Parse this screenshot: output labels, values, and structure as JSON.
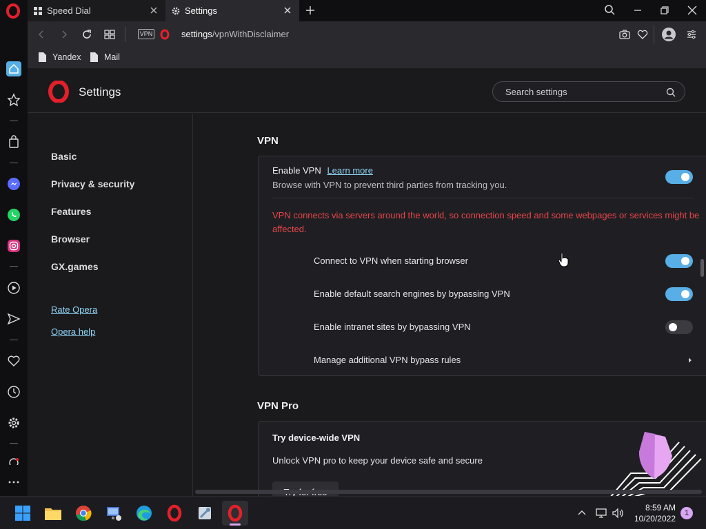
{
  "tabs": [
    {
      "label": "Speed Dial"
    },
    {
      "label": "Settings"
    }
  ],
  "address": {
    "url_host": "settings",
    "url_path": "/vpnWithDisclaimer",
    "vpn_badge": "VPN"
  },
  "bookmarks": [
    {
      "label": "Yandex"
    },
    {
      "label": "Mail"
    }
  ],
  "header": {
    "title": "Settings",
    "search_placeholder": "Search settings"
  },
  "nav": {
    "items": [
      {
        "label": "Basic"
      },
      {
        "label": "Privacy & security"
      },
      {
        "label": "Features"
      },
      {
        "label": "Browser"
      },
      {
        "label": "GX.games"
      }
    ],
    "links": [
      {
        "label": "Rate Opera"
      },
      {
        "label": "Opera help"
      }
    ]
  },
  "vpn": {
    "section_title": "VPN",
    "enable_label": "Enable VPN",
    "learn_more": "Learn more",
    "enable_desc": "Browse with VPN to prevent third parties from tracking you.",
    "enable_on": true,
    "warning": "VPN connects via servers around the world, so connection speed and some webpages or services might be affected.",
    "options": [
      {
        "label": "Connect to VPN when starting browser",
        "on": true
      },
      {
        "label": "Enable default search engines by bypassing VPN",
        "on": true
      },
      {
        "label": "Enable intranet sites by bypassing VPN",
        "on": false
      }
    ],
    "bypass_rules": "Manage additional VPN bypass rules"
  },
  "vpn_pro": {
    "section_title": "VPN Pro",
    "card_title": "Try device-wide VPN",
    "card_desc": "Unlock VPN pro to keep your device safe and secure",
    "button": "Try for free"
  },
  "taskbar": {
    "time": "8:59 AM",
    "date": "10/20/2022",
    "notifications": "1"
  },
  "colors": {
    "accent": "#58aee6",
    "opera_red": "#e3202a",
    "warning": "#e8454a"
  }
}
